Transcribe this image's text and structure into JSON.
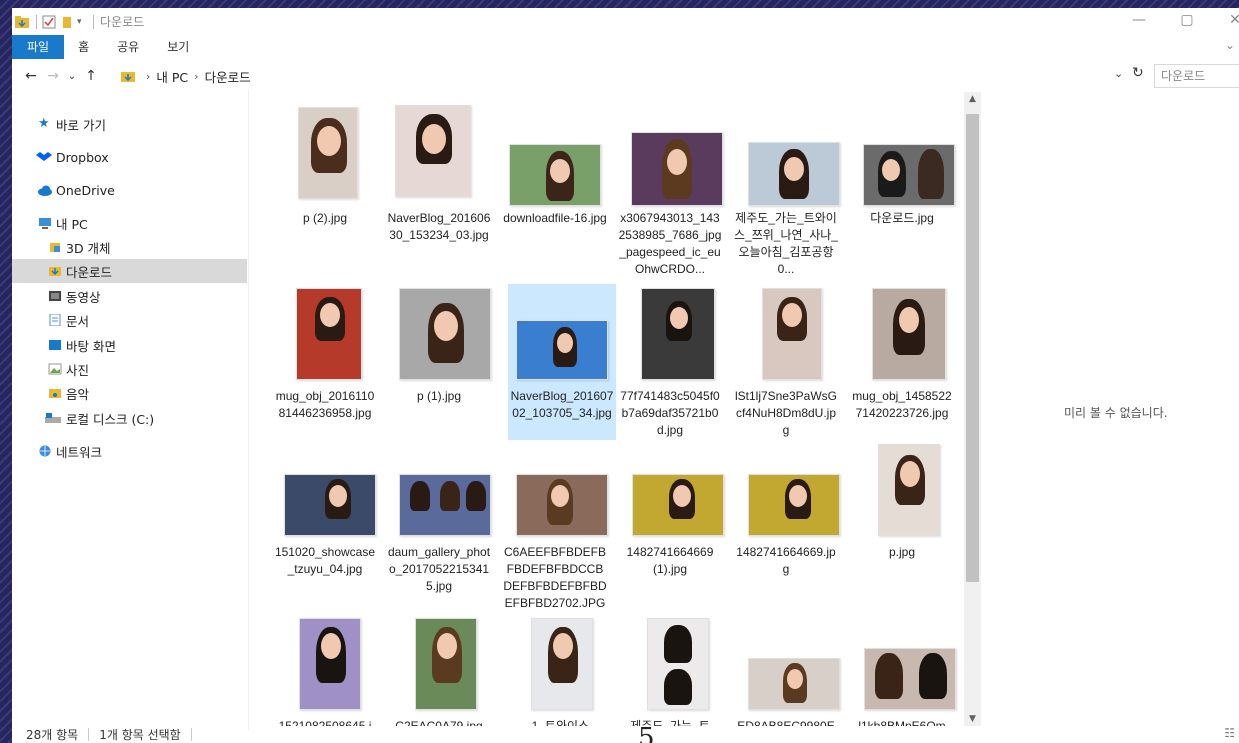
{
  "title": "다운로드",
  "ribbon": {
    "tabs": [
      "파일",
      "홈",
      "공유",
      "보기"
    ]
  },
  "address": {
    "this_pc": "내 PC",
    "folder": "다운로드"
  },
  "search": {
    "placeholder": "다운로드"
  },
  "nav": {
    "quick_access": "바로 가기",
    "dropbox": "Dropbox",
    "onedrive": "OneDrive",
    "this_pc": "내 PC",
    "objects3d": "3D 개체",
    "downloads": "다운로드",
    "videos": "동영상",
    "documents": "문서",
    "desktop": "바탕 화면",
    "pictures": "사진",
    "music": "음악",
    "local_disk": "로컬 디스크 (C:)",
    "network": "네트워크"
  },
  "files": [
    {
      "name": "p (2).jpg"
    },
    {
      "name": "NaverBlog_20160630_153234_03.jpg"
    },
    {
      "name": "downloadfile-16.jpg"
    },
    {
      "name": "x3067943013_1432538985_7686_jpg_pagespeed_ic_euOhwCRDO..."
    },
    {
      "name": "제주도_가는_트와이스_쯔위_나연_사나_오늘아침_김포공항0..."
    },
    {
      "name": "다운로드.jpg"
    },
    {
      "name": "mug_obj_201611081446236958.jpg"
    },
    {
      "name": "p (1).jpg"
    },
    {
      "name": "NaverBlog_20160702_103705_34.jpg"
    },
    {
      "name": "77f741483c5045f0b7a69daf35721b0d.jpg"
    },
    {
      "name": "lSt1lj7Sne3PaWsGcf4NuH8Dm8dU.jpg"
    },
    {
      "name": "mug_obj_145852271420223726.jpg"
    },
    {
      "name": "151020_showcase_tzuyu_04.jpg"
    },
    {
      "name": "daum_gallery_photo_20170522153415.jpg"
    },
    {
      "name": "C6AEEFBFBDEFBFBDEFBFBDCCBDEFBFBDEFBFBDEFBFBD2702.JPG"
    },
    {
      "name": "1482741664669(1).jpg"
    },
    {
      "name": "1482741664669.jpg"
    },
    {
      "name": "p.jpg"
    },
    {
      "name": "1521082508645.j"
    },
    {
      "name": "C2EAC0A79.jpg"
    },
    {
      "name": "_-_1_트와이스_"
    },
    {
      "name": "제주도_가는_트"
    },
    {
      "name": "ED8AB8EC9980E"
    },
    {
      "name": "l1kb8BMpE6Qm"
    }
  ],
  "preview_text": "미리 볼 수 없습니다.",
  "status": {
    "count": "28개 항목",
    "selected": "1개 항목 선택함"
  },
  "overlay_number": "5"
}
